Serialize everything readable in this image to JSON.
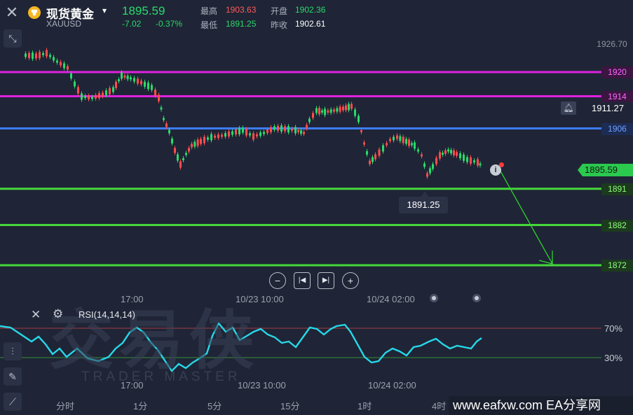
{
  "header": {
    "symbol_name": "现货黄金",
    "symbol_code": "XAUUSD",
    "caret": "▾",
    "price": "1895.59",
    "change": "-7.02",
    "change_pct": "-0.37%",
    "stats": [
      {
        "label": "最高",
        "value": "1903.63",
        "color": "#ff5a5a"
      },
      {
        "label": "开盘",
        "value": "1902.36",
        "color": "#2bd96b"
      },
      {
        "label": "最低",
        "value": "1891.25",
        "color": "#2bd96b"
      },
      {
        "label": "昨收",
        "value": "1902.61",
        "color": "#ffffff"
      }
    ]
  },
  "axis": {
    "top_value": "1926.70",
    "bell_value": "1911.27",
    "current": "1895.59",
    "low_marker": "1891.25"
  },
  "levels": [
    {
      "label": "1920",
      "color": "#e021e0"
    },
    {
      "label": "1914",
      "color": "#e021e0"
    },
    {
      "label": "1906",
      "color": "#3d7cff"
    },
    {
      "label": "1891",
      "color": "#46d83a"
    },
    {
      "label": "1882",
      "color": "#46d83a"
    },
    {
      "label": "1872",
      "color": "#46d83a"
    }
  ],
  "time_labels": [
    "17:00",
    "10/23 10:00",
    "10/24 02:00"
  ],
  "indicator": {
    "name": "RSI(14,14,14)",
    "upper": "70%",
    "lower": "30%"
  },
  "timeframes": [
    "分时",
    "1分",
    "5分",
    "15分",
    "1时",
    "4时"
  ],
  "watermark": {
    "cn": "交易侠",
    "en": "TRADER MASTER"
  },
  "footer": "www.eafxw.com  EA分享网",
  "icons": [
    "close-icon",
    "gold-coin-icon",
    "collapse-icon",
    "bell-icon",
    "info-icon",
    "zoom-out-icon",
    "step-back-icon",
    "step-forward-icon",
    "zoom-in-icon",
    "settings-icon",
    "indicators-icon",
    "pen-icon",
    "trend-icon"
  ]
}
